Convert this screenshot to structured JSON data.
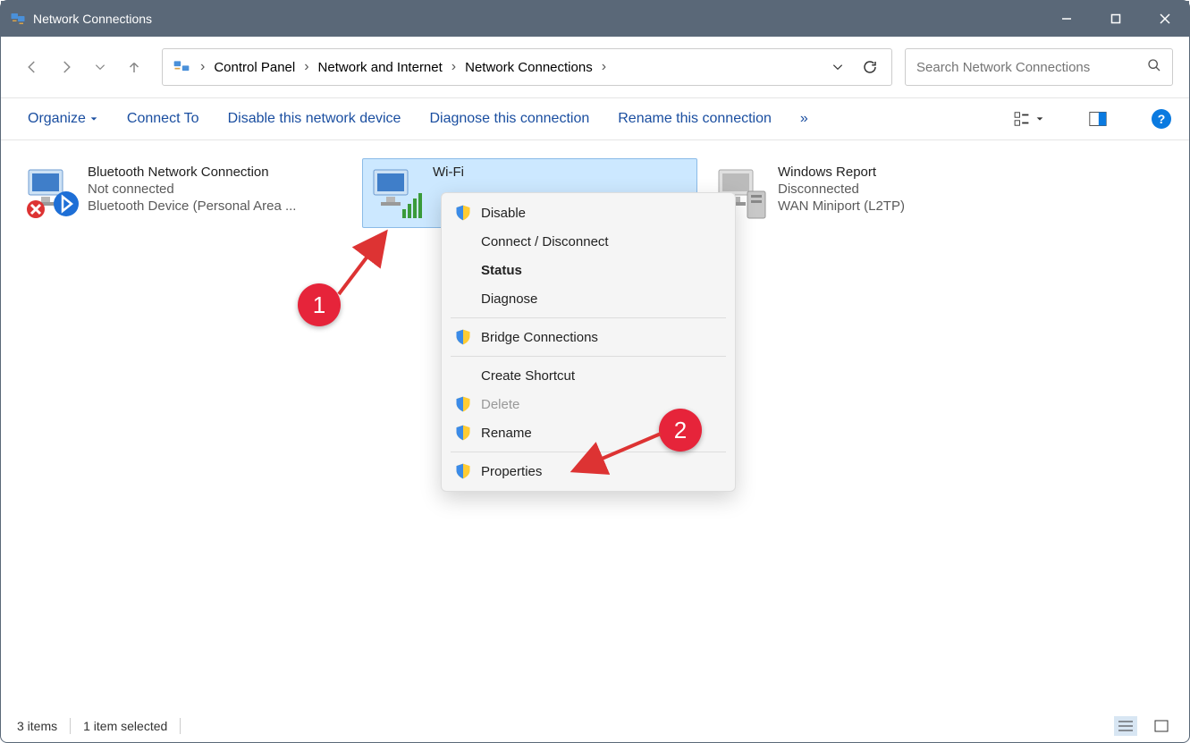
{
  "window": {
    "title": "Network Connections"
  },
  "breadcrumb": {
    "items": [
      "Control Panel",
      "Network and Internet",
      "Network Connections"
    ]
  },
  "search": {
    "placeholder": "Search Network Connections"
  },
  "toolbar": {
    "organize": "Organize",
    "connect_to": "Connect To",
    "disable": "Disable this network device",
    "diagnose": "Diagnose this connection",
    "rename": "Rename this connection",
    "overflow": "»"
  },
  "connections": [
    {
      "name": "Bluetooth Network Connection",
      "status": "Not connected",
      "device": "Bluetooth Device (Personal Area ..."
    },
    {
      "name": "Wi-Fi",
      "status": "",
      "device": ""
    },
    {
      "name": "Windows Report",
      "status": "Disconnected",
      "device": "WAN Miniport (L2TP)"
    }
  ],
  "context_menu": {
    "disable": "Disable",
    "connect": "Connect / Disconnect",
    "status": "Status",
    "diagnose": "Diagnose",
    "bridge": "Bridge Connections",
    "shortcut": "Create Shortcut",
    "delete": "Delete",
    "rename": "Rename",
    "properties": "Properties"
  },
  "annotations": {
    "step1": "1",
    "step2": "2"
  },
  "statusbar": {
    "items": "3 items",
    "selected": "1 item selected"
  }
}
